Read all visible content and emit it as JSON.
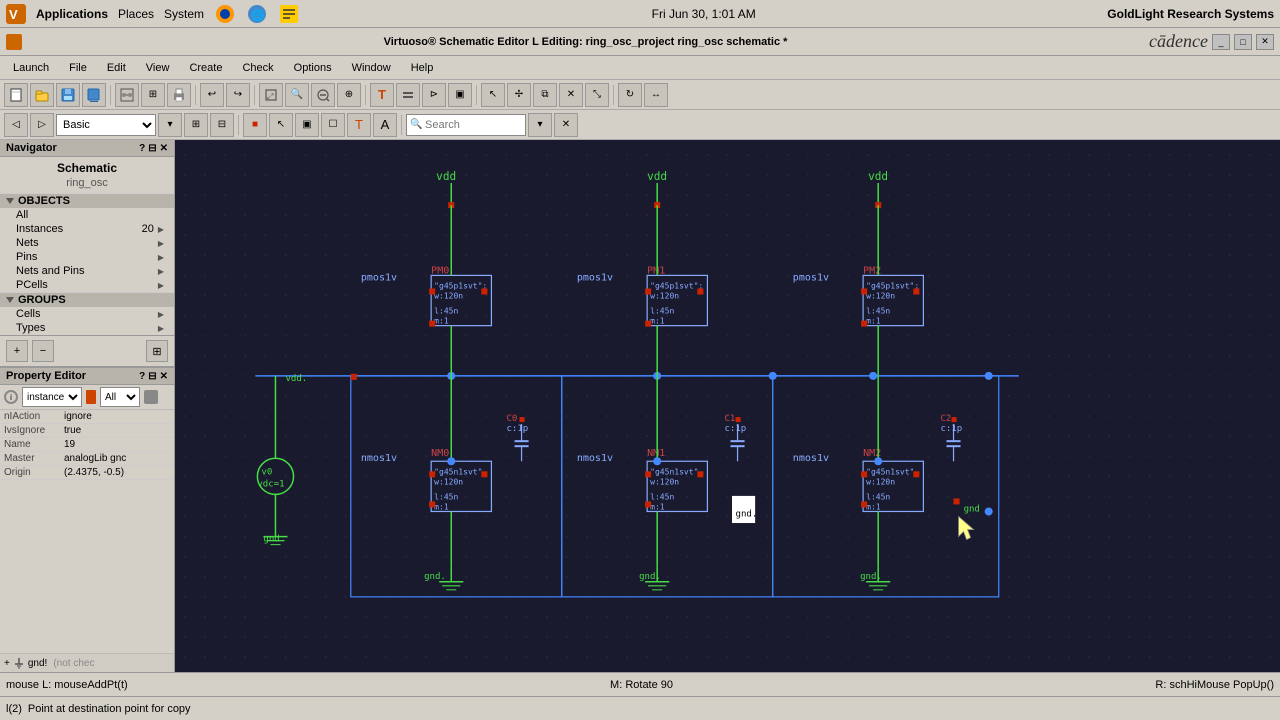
{
  "systemBar": {
    "apps": "Applications",
    "places": "Places",
    "system": "System",
    "time": "Fri Jun 30,  1:01 AM",
    "brand": "GoldLight Research Systems"
  },
  "titleBar": {
    "title": "Virtuoso® Schematic Editor L Editing: ring_osc_project ring_osc schematic *",
    "cadence": "cādence"
  },
  "menuBar": {
    "items": [
      "Launch",
      "File",
      "Edit",
      "View",
      "Create",
      "Check",
      "Options",
      "Window",
      "Help"
    ]
  },
  "toolbar2": {
    "modeLabel": "Basic",
    "searchPlaceholder": "Search"
  },
  "navigator": {
    "title": "Navigator",
    "subtitle": "Schematic",
    "lib": "ring_osc",
    "objectsSection": "OBJECTS",
    "groupsSection": "GROUPS",
    "objects": [
      {
        "label": "All",
        "count": "",
        "arrow": false
      },
      {
        "label": "Instances",
        "count": "20",
        "arrow": true
      },
      {
        "label": "Nets",
        "count": "",
        "arrow": true
      },
      {
        "label": "Pins",
        "count": "",
        "arrow": true
      },
      {
        "label": "Nets and Pins",
        "count": "",
        "arrow": true
      },
      {
        "label": "PCells",
        "count": "",
        "arrow": true
      }
    ],
    "groups": [
      {
        "label": "Cells",
        "count": "",
        "arrow": true
      },
      {
        "label": "Types",
        "count": "",
        "arrow": true
      }
    ]
  },
  "propertyEditor": {
    "title": "Property Editor",
    "instanceType": "instance",
    "filterAll": "All",
    "properties": [
      {
        "name": "nIAction",
        "value": "ignore"
      },
      {
        "name": "IvsIgnore",
        "value": "true"
      },
      {
        "name": "Name",
        "value": "19"
      },
      {
        "name": "Master",
        "value": "analogLib gnc"
      },
      {
        "name": "Origin",
        "value": "(2.4375, -0.5)"
      }
    ],
    "instanceRow": "gnd!"
  },
  "statusBar1": {
    "left": "mouse L: mouseAddPt(t)",
    "center": "M: Rotate 90",
    "right": "R: schHiMouse PopUp()"
  },
  "statusBar2": {
    "text": "Point at destination point for copy",
    "prefix": "l(2)"
  }
}
